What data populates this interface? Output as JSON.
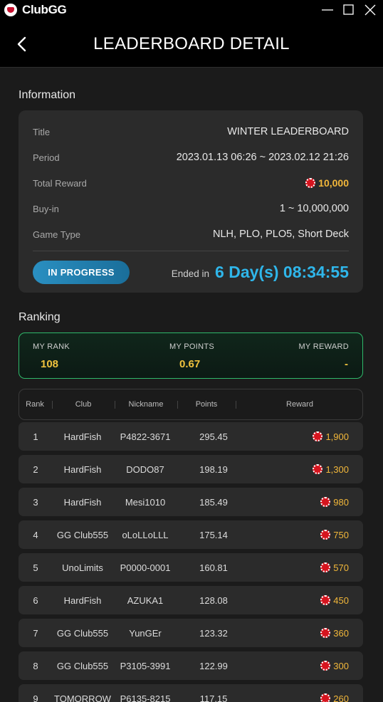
{
  "app": {
    "name": "ClubGG"
  },
  "header": {
    "title": "LEADERBOARD DETAIL"
  },
  "information": {
    "section_title": "Information",
    "rows": [
      {
        "label": "Title",
        "value": "WINTER LEADERBOARD"
      },
      {
        "label": "Period",
        "value": "2023.01.13 06:26 ~ 2023.02.12 21:26"
      },
      {
        "label": "Total Reward",
        "value": "10,000"
      },
      {
        "label": "Buy-in",
        "value": "1 ~ 10,000,000"
      },
      {
        "label": "Game Type",
        "value": "NLH, PLO, PLO5, Short Deck"
      }
    ],
    "status_button": "IN PROGRESS",
    "ended_label": "Ended in",
    "countdown": "6 Day(s) 08:34:55"
  },
  "ranking": {
    "section_title": "Ranking",
    "my_rank_label": "MY RANK",
    "my_rank": "108",
    "my_points_label": "MY POINTS",
    "my_points": "0.67",
    "my_reward_label": "MY REWARD",
    "my_reward": "-",
    "columns": [
      "Rank",
      "Club",
      "Nickname",
      "Points",
      "Reward"
    ],
    "rows": [
      {
        "rank": "1",
        "club": "HardFish",
        "nickname": "P4822-3671",
        "points": "295.45",
        "reward": "1,900"
      },
      {
        "rank": "2",
        "club": "HardFish",
        "nickname": "DODO87",
        "points": "198.19",
        "reward": "1,300"
      },
      {
        "rank": "3",
        "club": "HardFish",
        "nickname": "Mesi1010",
        "points": "185.49",
        "reward": "980"
      },
      {
        "rank": "4",
        "club": "GG Club555",
        "nickname": "oLoLLoLLL",
        "points": "175.14",
        "reward": "750"
      },
      {
        "rank": "5",
        "club": "UnoLimits",
        "nickname": "P0000-0001",
        "points": "160.81",
        "reward": "570"
      },
      {
        "rank": "6",
        "club": "HardFish",
        "nickname": "AZUKA1",
        "points": "128.08",
        "reward": "450"
      },
      {
        "rank": "7",
        "club": "GG Club555",
        "nickname": "YunGEr",
        "points": "123.32",
        "reward": "360"
      },
      {
        "rank": "8",
        "club": "GG Club555",
        "nickname": "P3105-3991",
        "points": "122.99",
        "reward": "300"
      },
      {
        "rank": "9",
        "club": "TOMORROW",
        "nickname": "P6135-8215",
        "points": "117.15",
        "reward": "260"
      }
    ]
  },
  "colors": {
    "accent_blue": "#2fb6ea",
    "reward_gold": "#f2b73a",
    "my_rank_border": "#2fb86a",
    "chip_red": "#d6141e"
  },
  "icons": [
    "clubgg-logo-icon",
    "minimize-icon",
    "maximize-icon",
    "close-icon",
    "back-arrow-icon",
    "chip-icon"
  ]
}
